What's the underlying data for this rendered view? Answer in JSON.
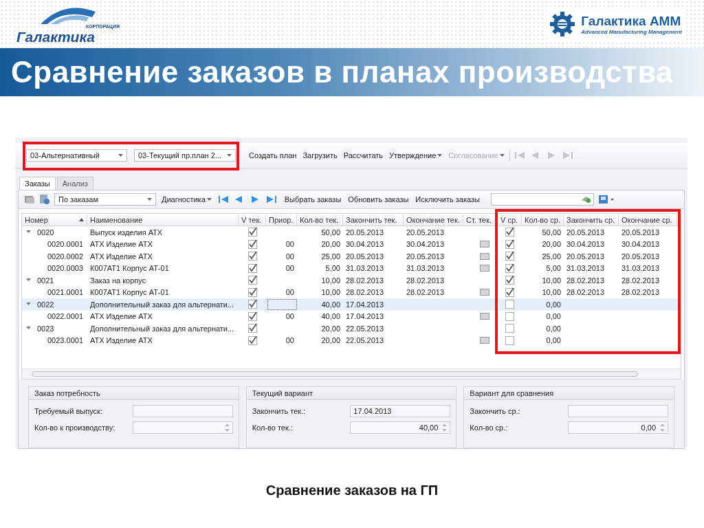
{
  "slide": {
    "title": "Сравнение заказов в планах производства",
    "caption": "Сравнение заказов на ГП",
    "logo_left": {
      "name": "Галактика",
      "tagline": "КОРПОРАЦИЯ"
    },
    "logo_right": {
      "name": "Галактика АММ",
      "tagline": "Advanced Manufacturing Management"
    }
  },
  "toolbar": {
    "combos": [
      {
        "value": "03-Альтернативный"
      },
      {
        "value": "03-Текущий пр.план 2..."
      }
    ],
    "buttons": [
      {
        "label": "Создать план",
        "kind": "button",
        "disabled": false
      },
      {
        "label": "Загрузить",
        "kind": "button",
        "disabled": false
      },
      {
        "label": "Рассчитать",
        "kind": "button",
        "disabled": false
      },
      {
        "label": "Утверждение",
        "kind": "menu",
        "disabled": false
      },
      {
        "label": "Согласование",
        "kind": "menu",
        "disabled": true
      }
    ],
    "navigation_disabled": true
  },
  "tabs": [
    {
      "label": "Заказы",
      "selected": true
    },
    {
      "label": "Анализ",
      "selected": false
    }
  ],
  "grid_toolbar": {
    "view_combo": "По заказам",
    "menu": "Диагностика",
    "navigation_disabled": false,
    "buttons": [
      "Выбрать заказы",
      "Обновить заказы",
      "Исключить заказы"
    ]
  },
  "table": {
    "columns": [
      {
        "label": "Номер",
        "sorted": true
      },
      {
        "label": "Наименование",
        "sorted": false
      },
      {
        "label": "V тек.",
        "sorted": false
      },
      {
        "label": "Приор.",
        "sorted": false
      },
      {
        "label": "Кол-во тек.",
        "sorted": false
      },
      {
        "label": "Закончить тек.",
        "sorted": false
      },
      {
        "label": "Окончание тек.",
        "sorted": false
      },
      {
        "label": "Ст. тек.",
        "sorted": false
      },
      {
        "label": "V ср.",
        "sorted": false
      },
      {
        "label": "Кол-во ср.",
        "sorted": false
      },
      {
        "label": "Закончить ср.",
        "sorted": false
      },
      {
        "label": "Окончание ср.",
        "sorted": false
      }
    ],
    "rows": [
      {
        "number": "0020",
        "name": "Выпуск изделия АТХ",
        "in_current": true,
        "qty": "50,00",
        "finish": "20.05.2013",
        "end": "20.05.2013",
        "status_flag": false,
        "in_compare": true,
        "qty_cmp": "50,00",
        "finish_cmp": "20.05.2013",
        "end_cmp": "20.05.2013",
        "selected": false,
        "expanded": true,
        "children": [
          {
            "number": "0020.0001",
            "name": "АТХ Изделие АТХ",
            "in_current": true,
            "prior": "00",
            "qty": "20,00",
            "finish": "30.04.2013",
            "end": "30.04.2013",
            "status_flag": true,
            "in_compare": true,
            "qty_cmp": "20,00",
            "finish_cmp": "30.04.2013",
            "end_cmp": "30.04.2013",
            "selected": false
          },
          {
            "number": "0020.0002",
            "name": "АТХ Изделие АТХ",
            "in_current": true,
            "prior": "00",
            "qty": "25,00",
            "finish": "20.05.2013",
            "end": "20.05.2013",
            "status_flag": true,
            "in_compare": true,
            "qty_cmp": "25,00",
            "finish_cmp": "20.05.2013",
            "end_cmp": "20.05.2013",
            "selected": false
          },
          {
            "number": "0020.0003",
            "name": "К007АТ1 Корпус АТ-01",
            "in_current": true,
            "prior": "00",
            "qty": "5,00",
            "finish": "31.03.2013",
            "end": "31.03.2013",
            "status_flag": true,
            "in_compare": true,
            "qty_cmp": "5,00",
            "finish_cmp": "31.03.2013",
            "end_cmp": "31.03.2013",
            "selected": false
          }
        ]
      },
      {
        "number": "0021",
        "name": "Заказ на корпус",
        "in_current": true,
        "qty": "10,00",
        "finish": "28.02.2013",
        "end": "28.02.2013",
        "status_flag": false,
        "in_compare": true,
        "qty_cmp": "10,00",
        "finish_cmp": "28.02.2013",
        "end_cmp": "28.02.2013",
        "selected": false,
        "expanded": true,
        "children": [
          {
            "number": "0021.0001",
            "name": "К007АТ1 Корпус АТ-01",
            "in_current": true,
            "prior": "00",
            "qty": "10,00",
            "finish": "28.02.2013",
            "end": "28.02.2013",
            "status_flag": true,
            "in_compare": true,
            "qty_cmp": "10,00",
            "finish_cmp": "28.02.2013",
            "end_cmp": "28.02.2013",
            "selected": false
          }
        ]
      },
      {
        "number": "0022",
        "name": "Дополнительный заказ для альтернати...",
        "in_current": true,
        "qty": "40,00",
        "finish": "17.04.2013",
        "status_flag": false,
        "in_compare": false,
        "qty_cmp": "0,00",
        "selected": true,
        "expanded": true,
        "children": [
          {
            "number": "0022.0001",
            "name": "АТХ Изделие АТХ",
            "in_current": true,
            "prior": "00",
            "qty": "40,00",
            "finish": "17.04.2013",
            "status_flag": true,
            "in_compare": false,
            "qty_cmp": "0,00",
            "selected": false
          }
        ]
      },
      {
        "number": "0023",
        "name": "Дополнительный заказ для альтернати...",
        "in_current": true,
        "qty": "20,00",
        "finish": "22.05.2013",
        "status_flag": false,
        "in_compare": false,
        "qty_cmp": "0,00",
        "selected": false,
        "expanded": true,
        "children": [
          {
            "number": "0023.0001",
            "name": "АТХ Изделие АТХ",
            "in_current": true,
            "prior": "00",
            "qty": "20,00",
            "finish": "22.05.2013",
            "status_flag": true,
            "in_compare": false,
            "qty_cmp": "0,00",
            "selected": false
          }
        ]
      }
    ]
  },
  "groups": [
    {
      "title": "Заказ потребность",
      "fields": [
        {
          "label": "Требуемый выпуск:",
          "kind": "text"
        },
        {
          "label": "Кол-во к производству:",
          "kind": "spin"
        }
      ]
    },
    {
      "title": "Текущий вариант",
      "fields": [
        {
          "label": "Закончить тек.:",
          "kind": "text",
          "value": "17.04.2013"
        },
        {
          "label": "Кол-во тек.:",
          "kind": "spin",
          "value": "40,00"
        }
      ]
    },
    {
      "title": "Вариант для сравнения",
      "fields": [
        {
          "label": "Закончить ср.:",
          "kind": "text"
        },
        {
          "label": "Кол-во ср.:",
          "kind": "spin",
          "value": "0,00"
        }
      ]
    }
  ]
}
